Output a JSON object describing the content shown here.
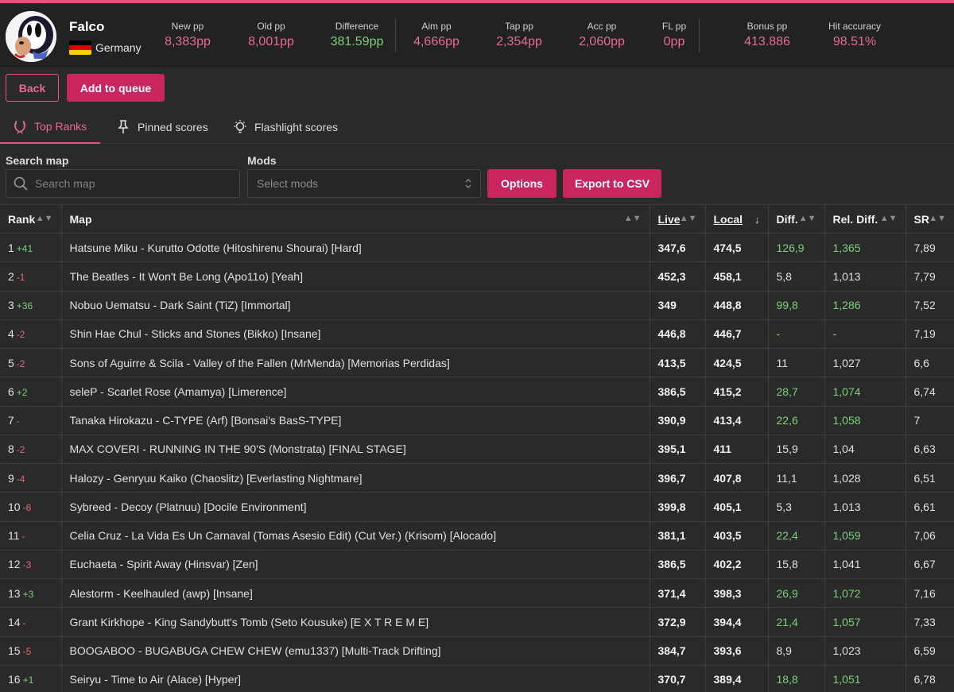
{
  "user": {
    "name": "Falco",
    "country": "Germany"
  },
  "stats": [
    {
      "label": "New pp",
      "value": "8,383pp"
    },
    {
      "label": "Old pp",
      "value": "8,001pp"
    },
    {
      "label": "Difference",
      "value": "381.59pp"
    },
    {
      "label": "Aim pp",
      "value": "4,666pp"
    },
    {
      "label": "Tap pp",
      "value": "2,354pp"
    },
    {
      "label": "Acc pp",
      "value": "2,060pp"
    },
    {
      "label": "FL pp",
      "value": "0pp"
    },
    {
      "label": "Bonus pp",
      "value": "413.886"
    },
    {
      "label": "Hit accuracy",
      "value": "98.51%"
    }
  ],
  "colors": {
    "accent": "#e0567f",
    "button": "#c9255f",
    "positive": "#7cd17c",
    "negative": "#e8667a",
    "neutral": "#d8c15a"
  },
  "actions": {
    "back": "Back",
    "add_to_queue": "Add to queue"
  },
  "tabs": [
    {
      "label": "Top Ranks",
      "icon": "laurel-icon"
    },
    {
      "label": "Pinned scores",
      "icon": "pin-icon"
    },
    {
      "label": "Flashlight scores",
      "icon": "lightbulb-icon"
    }
  ],
  "filters": {
    "search_label": "Search map",
    "search_placeholder": "Search map",
    "mods_label": "Mods",
    "mods_placeholder": "Select mods",
    "options": "Options",
    "export": "Export to CSV"
  },
  "table": {
    "columns": [
      "Rank",
      "Map",
      "Live",
      "Local",
      "Diff.",
      "Rel. Diff.",
      "SR"
    ],
    "rows": [
      {
        "rank": "1",
        "change": "+41",
        "dir": "up",
        "map": "Hatsune Miku - Kurutto Odotte (Hitoshirenu Shourai) [Hard]",
        "live": "347,6",
        "local": "474,5",
        "diff": "126,9",
        "rel": "1,365",
        "sr": "7,89",
        "tone": "green"
      },
      {
        "rank": "2",
        "change": "-1",
        "dir": "down",
        "map": "The Beatles - It Won't Be Long (Apo11o) [Yeah]",
        "live": "452,3",
        "local": "458,1",
        "diff": "5,8",
        "rel": "1,013",
        "sr": "7,79",
        "tone": "plain"
      },
      {
        "rank": "3",
        "change": "+36",
        "dir": "up",
        "map": "Nobuo Uematsu - Dark Saint (TiZ) [Immortal]",
        "live": "349",
        "local": "448,8",
        "diff": "99,8",
        "rel": "1,286",
        "sr": "7,52",
        "tone": "green"
      },
      {
        "rank": "4",
        "change": "-2",
        "dir": "down",
        "map": "Shin Hae Chul - Sticks and Stones (Bikko) [Insane]",
        "live": "446,8",
        "local": "446,7",
        "diff": "-",
        "rel": "-",
        "sr": "7,19",
        "tone": "yellow"
      },
      {
        "rank": "5",
        "change": "-2",
        "dir": "down",
        "map": "Sons of Aguirre & Scila - Valley of the Fallen (MrMenda) [Memorias Perdidas]",
        "live": "413,5",
        "local": "424,5",
        "diff": "11",
        "rel": "1,027",
        "sr": "6,6",
        "tone": "plain"
      },
      {
        "rank": "6",
        "change": "+2",
        "dir": "up",
        "map": "seleP - Scarlet Rose (Amamya) [Limerence]",
        "live": "386,5",
        "local": "415,2",
        "diff": "28,7",
        "rel": "1,074",
        "sr": "6,74",
        "tone": "lightgreen"
      },
      {
        "rank": "7",
        "change": "-",
        "dir": "down",
        "map": "Tanaka Hirokazu - C-TYPE (Arf) [Bonsai's BasS-TYPE]",
        "live": "390,9",
        "local": "413,4",
        "diff": "22,6",
        "rel": "1,058",
        "sr": "7",
        "tone": "lightgreen"
      },
      {
        "rank": "8",
        "change": "-2",
        "dir": "down",
        "map": "MAX COVERI - RUNNING IN THE 90'S (Monstrata) [FINAL STAGE]",
        "live": "395,1",
        "local": "411",
        "diff": "15,9",
        "rel": "1,04",
        "sr": "6,63",
        "tone": "plain"
      },
      {
        "rank": "9",
        "change": "-4",
        "dir": "down",
        "map": "Halozy - Genryuu Kaiko (Chaoslitz) [Everlasting Nightmare]",
        "live": "396,7",
        "local": "407,8",
        "diff": "11,1",
        "rel": "1,028",
        "sr": "6,51",
        "tone": "plain"
      },
      {
        "rank": "10",
        "change": "-6",
        "dir": "down",
        "map": "Sybreed - Decoy (Platnuu) [Docile Environment]",
        "live": "399,8",
        "local": "405,1",
        "diff": "5,3",
        "rel": "1,013",
        "sr": "6,61",
        "tone": "plain"
      },
      {
        "rank": "11",
        "change": "-",
        "dir": "down",
        "map": "Celia Cruz - La Vida Es Un Carnaval (Tomas Asesio Edit) (Cut Ver.) (Krisom) [Alocado]",
        "live": "381,1",
        "local": "403,5",
        "diff": "22,4",
        "rel": "1,059",
        "sr": "7,06",
        "tone": "lightgreen"
      },
      {
        "rank": "12",
        "change": "-3",
        "dir": "down",
        "map": "Euchaeta - Spirit Away (Hinsvar) [Zen]",
        "live": "386,5",
        "local": "402,2",
        "diff": "15,8",
        "rel": "1,041",
        "sr": "6,67",
        "tone": "plain"
      },
      {
        "rank": "13",
        "change": "+3",
        "dir": "up",
        "map": "Alestorm - Keelhauled (awp) [Insane]",
        "live": "371,4",
        "local": "398,3",
        "diff": "26,9",
        "rel": "1,072",
        "sr": "7,16",
        "tone": "lightgreen"
      },
      {
        "rank": "14",
        "change": "-",
        "dir": "down",
        "map": "Grant Kirkhope - King Sandybutt's Tomb (Seto Kousuke) [E X T R E M E]",
        "live": "372,9",
        "local": "394,4",
        "diff": "21,4",
        "rel": "1,057",
        "sr": "7,33",
        "tone": "lightgreen"
      },
      {
        "rank": "15",
        "change": "-5",
        "dir": "down",
        "map": "BOOGABOO - BUGABUGA CHEW CHEW (emu1337) [Multi-Track Drifting]",
        "live": "384,7",
        "local": "393,6",
        "diff": "8,9",
        "rel": "1,023",
        "sr": "6,59",
        "tone": "plain"
      },
      {
        "rank": "16",
        "change": "+1",
        "dir": "up",
        "map": "Seiryu - Time to Air (Alace) [Hyper]",
        "live": "370,7",
        "local": "389,4",
        "diff": "18,8",
        "rel": "1,051",
        "sr": "6,78",
        "tone": "lightgreen"
      }
    ]
  }
}
